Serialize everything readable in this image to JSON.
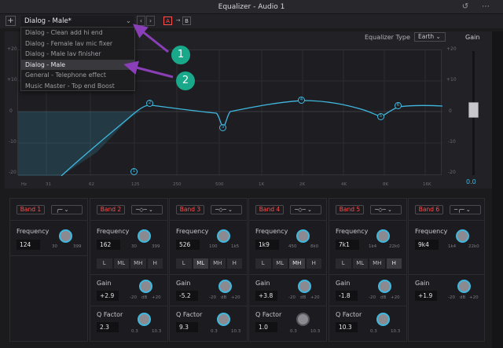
{
  "window": {
    "title": "Equalizer - Audio 1"
  },
  "toolbar": {
    "preset": "Dialog - Male*",
    "a": "A",
    "b": "B",
    "add": "+"
  },
  "presets": [
    "Dialog - Clean add hi end",
    "Dialog - Female lav mic fixer",
    "Dialog - Male lav finisher",
    "Dialog - Male",
    "General - Telephone effect",
    "Music Master - Top end Boost"
  ],
  "header": {
    "eq_type_label": "Equalizer Type",
    "eq_type_value": "Earth",
    "gain_label": "Gain",
    "gain_value": "0.0"
  },
  "graph": {
    "y_ticks_left": [
      "+20",
      "+10",
      "0",
      "-10",
      "-20"
    ],
    "y_ticks_right": [
      "+20",
      "+10",
      "0",
      "-10",
      "-20"
    ],
    "freq_ticks": [
      "Hz",
      "31",
      "62",
      "125",
      "250",
      "500",
      "1K",
      "2K",
      "4K",
      "8K",
      "16K"
    ],
    "nodes": [
      "1",
      "2",
      "3",
      "4",
      "5",
      "6"
    ]
  },
  "bands": [
    {
      "label": "Band 1",
      "type": "lowcut",
      "freq_label": "Frequency",
      "freq": "124",
      "min": "30",
      "max": "399"
    },
    {
      "label": "Band 2",
      "type": "bell",
      "freq_label": "Frequency",
      "freq": "162",
      "min": "30",
      "max": "399",
      "seg": [
        "L",
        "ML",
        "MH",
        "H"
      ],
      "gain_label": "Gain",
      "gain": "+2.9",
      "q_label": "Q Factor",
      "q": "2.3",
      "qmin": "0.3",
      "qmax": "10.3"
    },
    {
      "label": "Band 3",
      "type": "bell",
      "freq_label": "Frequency",
      "freq": "526",
      "min": "100",
      "max": "1k5",
      "seg": [
        "L",
        "ML",
        "MH",
        "H"
      ],
      "gain_label": "Gain",
      "gain": "-5.2",
      "q_label": "Q Factor",
      "q": "9.3",
      "qmin": "0.3",
      "qmax": "10.3"
    },
    {
      "label": "Band 4",
      "type": "bell",
      "freq_label": "Frequency",
      "freq": "1k9",
      "min": "450",
      "max": "8k0",
      "seg": [
        "L",
        "ML",
        "MH",
        "H"
      ],
      "gain_label": "Gain",
      "gain": "+3.8",
      "q_label": "Q Factor",
      "q": "1.0",
      "qmin": "0.3",
      "qmax": "10.3"
    },
    {
      "label": "Band 5",
      "type": "bell",
      "freq_label": "Frequency",
      "freq": "7k1",
      "min": "1k4",
      "max": "22k0",
      "seg": [
        "L",
        "ML",
        "MH",
        "H"
      ],
      "gain_label": "Gain",
      "gain": "-1.8",
      "q_label": "Q Factor",
      "q": "10.3",
      "qmin": "0.3",
      "qmax": "10.3"
    },
    {
      "label": "Band 6",
      "type": "highshelf",
      "freq_label": "Frequency",
      "freq": "9k4",
      "min": "1k4",
      "max": "22k0",
      "gain_label": "Gain",
      "gain": "+1.9"
    }
  ],
  "gain_scale": {
    "min": "-20",
    "unit": "dB",
    "max": "+20"
  },
  "callouts": [
    "1",
    "2"
  ],
  "colors": {
    "accent": "#3fb8e0",
    "band_label": "#ff4d4d",
    "callout": "#1aa88a",
    "arrow": "#8a3fb8"
  }
}
